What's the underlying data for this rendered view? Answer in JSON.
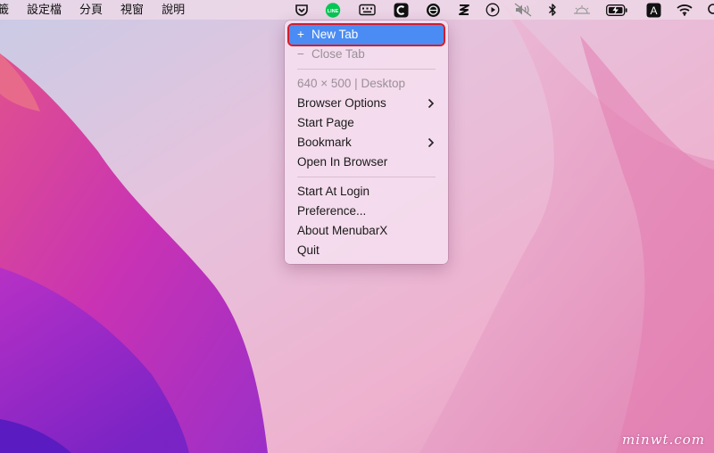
{
  "menubar": {
    "menus": [
      "籤",
      "設定檔",
      "分頁",
      "視窗",
      "說明"
    ],
    "status_icons": [
      "pocket-icon",
      "line-app-icon",
      "keyboard-icon",
      "c-app-icon",
      "vpn-globe-icon",
      "squiggle-app-icon",
      "play-icon",
      "speaker-muted-icon",
      "bluetooth-icon",
      "brightness-icon",
      "battery-charging-icon",
      "text-input-a-icon",
      "wifi-icon",
      "search-icon"
    ],
    "line_label": "LINE",
    "input_label": "A"
  },
  "dropdown": {
    "new_tab": {
      "prefix": "+",
      "label": "New Tab"
    },
    "close_tab": {
      "prefix": "−",
      "label": "Close Tab"
    },
    "viewport": "640 × 500 | Desktop",
    "browser_options": "Browser Options",
    "start_page": "Start Page",
    "bookmark": "Bookmark",
    "open_in_browser": "Open In Browser",
    "start_at_login": "Start At Login",
    "preference": "Preference...",
    "about": "About MenubarX",
    "quit": "Quit",
    "chevron": "›"
  },
  "watermark": "minwt.com",
  "colors": {
    "highlight": "#4a8cf3",
    "annotation_border": "#d31d2a",
    "line_green": "#06c755"
  }
}
